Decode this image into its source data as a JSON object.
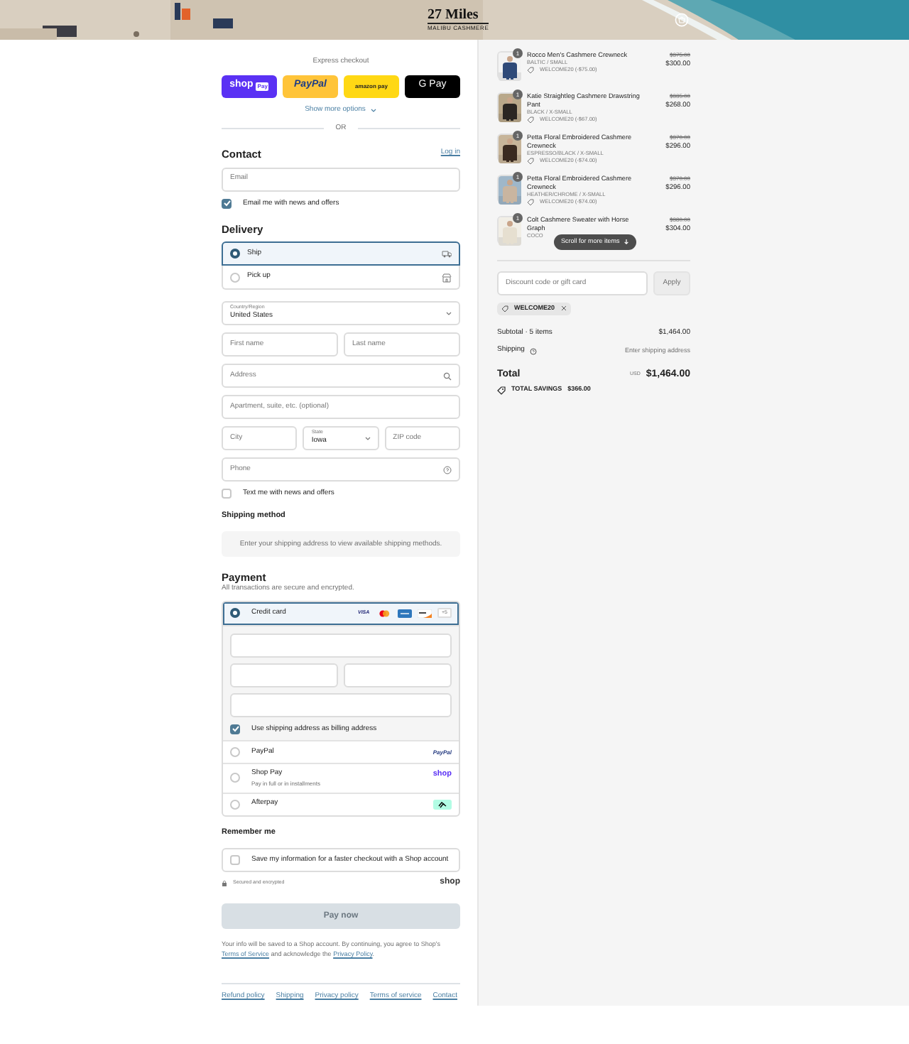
{
  "header": {
    "logo_title": "27 Miles",
    "logo_subtitle": "MALIBU CASHMERE"
  },
  "express": {
    "title": "Express checkout",
    "buttons": [
      {
        "kind": "shop",
        "label": "shop",
        "badge": "Pay"
      },
      {
        "kind": "paypal",
        "label": "PayPal"
      },
      {
        "kind": "amazon",
        "label": "amazon pay"
      },
      {
        "kind": "gpay",
        "label": "G Pay"
      }
    ],
    "more": "Show more options",
    "divider": "OR"
  },
  "contact": {
    "heading": "Contact",
    "login": "Log in",
    "email_placeholder": "Email",
    "news": {
      "label": "Email me with news and offers",
      "checked": true
    }
  },
  "delivery": {
    "heading": "Delivery",
    "options": [
      {
        "kind": "ship",
        "label": "Ship",
        "selected": true
      },
      {
        "kind": "pickup",
        "label": "Pick up",
        "selected": false
      }
    ],
    "country": {
      "label": "Country/Region",
      "value": "United States"
    },
    "first_name": {
      "placeholder": "First name"
    },
    "last_name": {
      "placeholder": "Last name"
    },
    "address": {
      "placeholder": "Address"
    },
    "apartment": {
      "placeholder": "Apartment, suite, etc. (optional)"
    },
    "city": {
      "placeholder": "City"
    },
    "state": {
      "label": "State",
      "value": "Iowa"
    },
    "zip": {
      "placeholder": "ZIP code"
    },
    "phone": {
      "placeholder": "Phone"
    },
    "text_me": {
      "label": "Text me with news and offers",
      "checked": false
    }
  },
  "shipping_method": {
    "heading": "Shipping method",
    "note": "Enter your shipping address to view available shipping methods."
  },
  "payment": {
    "heading": "Payment",
    "subtitle": "All transactions are secure and encrypted.",
    "methods": [
      {
        "kind": "card",
        "label": "Credit card",
        "selected": true,
        "logos": [
          {
            "kind": "visa",
            "text": "VISA"
          },
          {
            "kind": "mastercard"
          },
          {
            "kind": "amex"
          },
          {
            "kind": "discover"
          }
        ],
        "more": "+5"
      },
      {
        "kind": "paypal",
        "label": "PayPal",
        "selected": false,
        "logo": "PayPal"
      },
      {
        "kind": "shoppay",
        "label": "Shop Pay",
        "selected": false,
        "sub": "Pay in full or in installments",
        "logo": "shop"
      },
      {
        "kind": "afterpay",
        "label": "Afterpay",
        "selected": false
      }
    ],
    "billing": {
      "label": "Use shipping address as billing address",
      "checked": true
    }
  },
  "remember": {
    "heading": "Remember me",
    "save": {
      "label": "Save my information for a faster checkout with a Shop account",
      "checked": false
    },
    "secured": "Secured and encrypted",
    "shop_logo": "shop"
  },
  "pay_button": {
    "label": "Pay now",
    "disabled": true
  },
  "legal": {
    "before": "Your info will be saved to a Shop account. By continuing, you agree to Shop's ",
    "terms": "Terms of Service",
    "middle": " and acknowledge the ",
    "privacy": "Privacy Policy",
    "end": "."
  },
  "footer_links": [
    "Refund policy",
    "Shipping",
    "Privacy policy",
    "Terms of service",
    "Contact"
  ],
  "summary": {
    "items": [
      {
        "name": "Rocco Men's Cashmere Crewneck",
        "variant": "BALTIC / SMALL",
        "discount": "WELCOME20 (-$75.00)",
        "original": "$375.00",
        "price": "$300.00",
        "quantity": "1"
      },
      {
        "name": "Katie Straightleg Cashmere Drawstring Pant",
        "variant": "BLACK / X-SMALL",
        "discount": "WELCOME20 (-$67.00)",
        "original": "$335.00",
        "price": "$268.00",
        "quantity": "1"
      },
      {
        "name": "Petta Floral Embroidered Cashmere Crewneck",
        "variant": "ESPRESSO/BLACK / X-SMALL",
        "discount": "WELCOME20 (-$74.00)",
        "original": "$370.00",
        "price": "$296.00",
        "quantity": "1"
      },
      {
        "name": "Petta Floral Embroidered Cashmere Crewneck",
        "variant": "HEATHER/CHROME / X-SMALL",
        "discount": "WELCOME20 (-$74.00)",
        "original": "$370.00",
        "price": "$296.00",
        "quantity": "1"
      },
      {
        "name": "Colt Cashmere Sweater with Horse Graph",
        "variant": "COCO",
        "original": "$380.00",
        "price": "$304.00",
        "quantity": "1"
      }
    ],
    "scroll_hint": "Scroll for more items",
    "discount_placeholder": "Discount code or gift card",
    "apply": "Apply",
    "applied_code": "WELCOME20",
    "subtotal_label": "Subtotal · 5 items",
    "subtotal": "$1,464.00",
    "shipping_label": "Shipping",
    "shipping_value": "Enter shipping address",
    "total_label": "Total",
    "currency": "USD",
    "total": "$1,464.00",
    "savings_label": "TOTAL SAVINGS",
    "savings": "$366.00"
  }
}
